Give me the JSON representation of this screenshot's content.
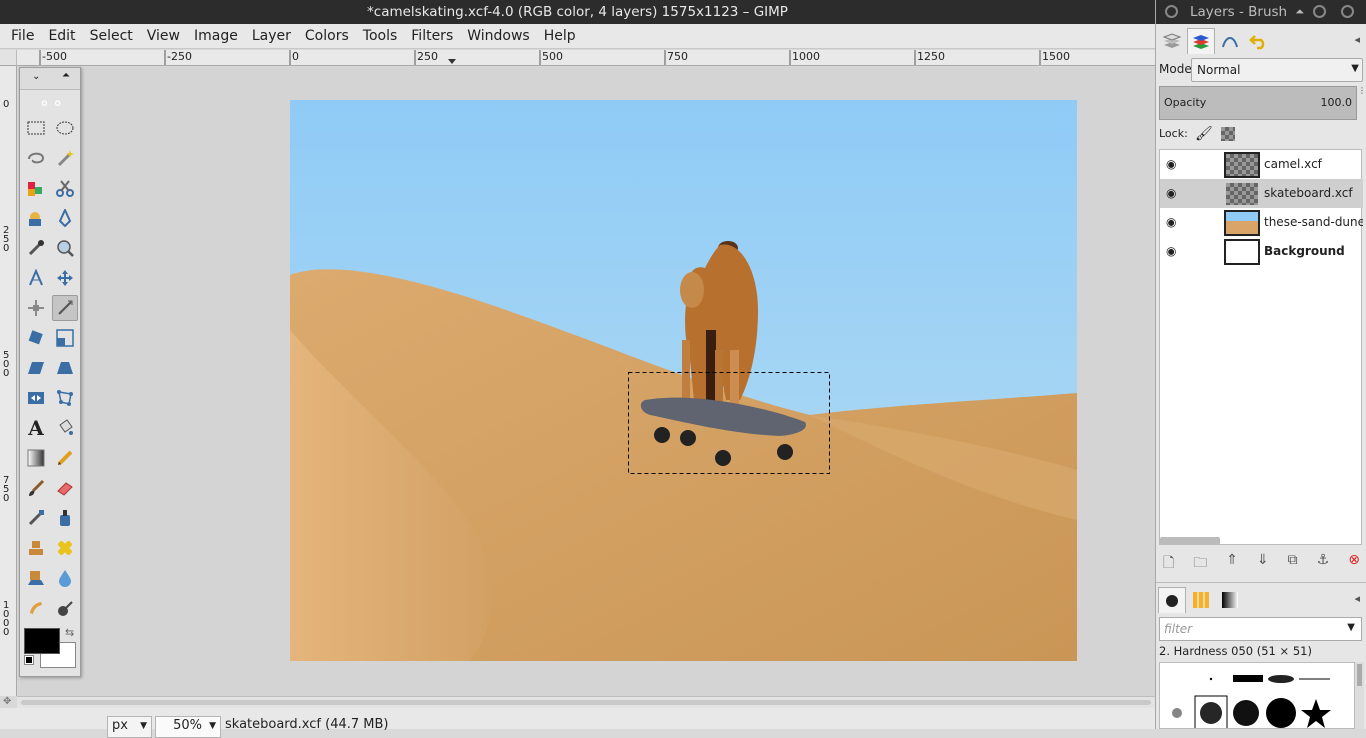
{
  "window": {
    "title": "*camelskating.xcf-4.0 (RGB color, 4 layers) 1575x1123 – GIMP"
  },
  "menu": [
    "File",
    "Edit",
    "Select",
    "View",
    "Image",
    "Layer",
    "Colors",
    "Tools",
    "Filters",
    "Windows",
    "Help"
  ],
  "ruler": {
    "h_labels": [
      "-500",
      "-250",
      "0",
      "250",
      "500",
      "750",
      "1000",
      "1250",
      "1500"
    ],
    "v_labels": [
      "0",
      "2 5 0",
      "5 0 0",
      "7 5 0",
      "1 0 0 0"
    ]
  },
  "status": {
    "unit": "px",
    "zoom": "50%",
    "info": "skateboard.xcf (44.7 MB)"
  },
  "dock": {
    "title": "Layers - Brush",
    "mode_label": "Mode:",
    "mode_value": "Normal",
    "opacity_label": "Opacity",
    "opacity_value": "100.0",
    "lock_label": "Lock:",
    "layers": [
      {
        "name": "camel.xcf",
        "bold": false,
        "selected": false
      },
      {
        "name": "skateboard.xcf",
        "bold": false,
        "selected": true
      },
      {
        "name": "these-sand-dunes-in",
        "bold": false,
        "selected": false
      },
      {
        "name": "Background",
        "bold": true,
        "selected": false
      }
    ],
    "brush_filter_placeholder": "filter",
    "brush_name": "2. Hardness 050 (51 × 51)"
  },
  "colors": {
    "fg": "#000000",
    "bg": "#ffffff",
    "sky": "#8fccf5",
    "sand": "#d9a468"
  }
}
